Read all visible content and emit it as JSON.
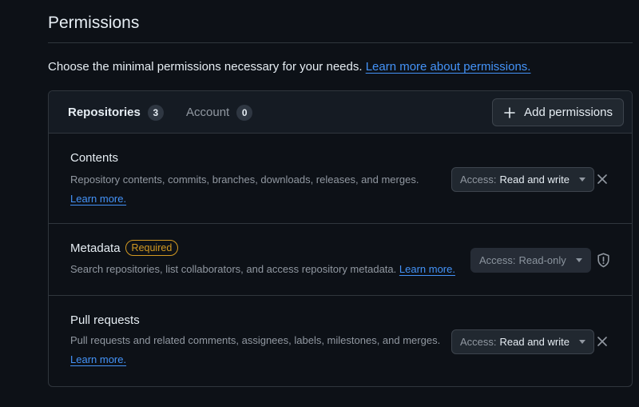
{
  "page": {
    "title": "Permissions",
    "intro_text": "Choose the minimal permissions necessary for your needs.",
    "intro_link": "Learn more about permissions."
  },
  "tabs": [
    {
      "label": "Repositories",
      "count": "3",
      "selected": true
    },
    {
      "label": "Account",
      "count": "0",
      "selected": false
    }
  ],
  "toolbar": {
    "add_label": "Add permissions",
    "add_icon": "plus-icon"
  },
  "permissions": [
    {
      "name": "Contents",
      "badge": "",
      "description": "Repository contents, commits, branches, downloads, releases, and merges.",
      "learn_more": "Learn more.",
      "access_label": "Access:",
      "access_value": "Read and write",
      "action_icon": "close-icon"
    },
    {
      "name": "Metadata",
      "badge": "Required",
      "description": "Search repositories, list collaborators, and access repository metadata.",
      "learn_more": "Learn more.",
      "access_label": "Access:",
      "access_value": "Read-only",
      "action_icon": "shield-icon"
    },
    {
      "name": "Pull requests",
      "badge": "",
      "description": "Pull requests and related comments, assignees, labels, milestones, and merges.",
      "learn_more": "Learn more.",
      "access_label": "Access:",
      "access_value": "Read and write",
      "action_icon": "close-icon"
    }
  ],
  "colors": {
    "background": "#0d1117",
    "link": "#4493f8",
    "required": "#d29922",
    "border": "#30363d"
  }
}
